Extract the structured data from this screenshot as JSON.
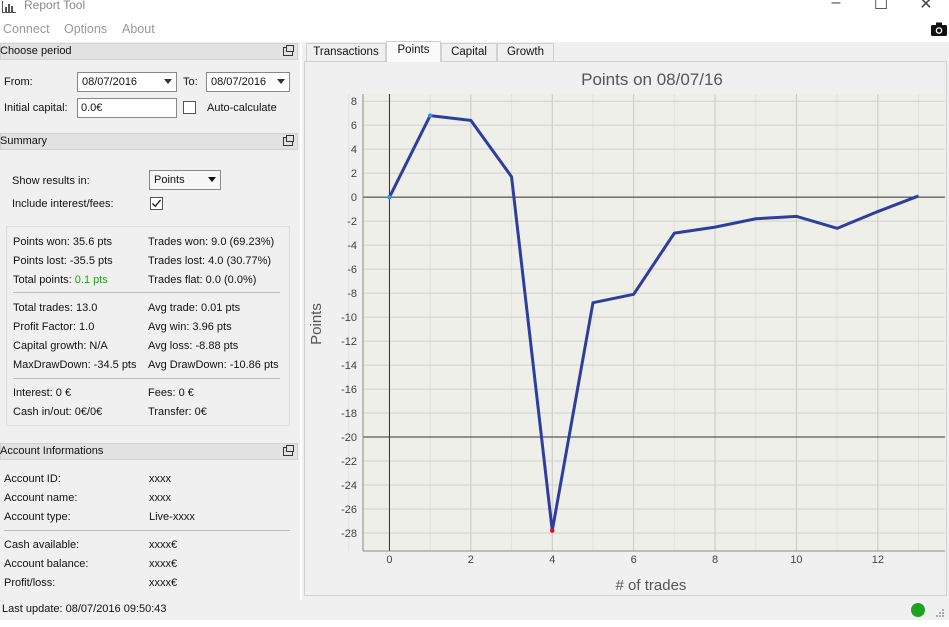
{
  "window": {
    "title": "Report Tool"
  },
  "menu": [
    "Connect",
    "Options",
    "About"
  ],
  "period": {
    "header": "Choose period",
    "from_label": "From:",
    "from_value": "08/07/2016",
    "to_label": "To:",
    "to_value": "08/07/2016",
    "capital_label": "Initial capital:",
    "capital_value": "0.0€",
    "autocalc_label": "Auto-calculate"
  },
  "summary": {
    "header": "Summary",
    "show_label": "Show results in:",
    "show_value": "Points",
    "include_label": "Include interest/fees:",
    "rows": [
      [
        "Points won: 35.6 pts",
        "Trades won: 9.0 (69.23%)"
      ],
      [
        "Points lost: -35.5 pts",
        "Trades lost: 4.0 (30.77%)"
      ],
      [
        "Total points: ",
        "Trades flat: 0.0 (0.0%)"
      ],
      [
        "Total trades: 13.0",
        "Avg trade: 0.01 pts"
      ],
      [
        "Profit Factor: 1.0",
        "Avg win: 3.96 pts"
      ],
      [
        "Capital growth: N/A",
        "Avg loss: -8.88 pts"
      ],
      [
        "MaxDrawDown: -34.5 pts",
        "Avg DrawDown: -10.86 pts"
      ],
      [
        "Interest: 0 €",
        "Fees: 0 €"
      ],
      [
        "Cash in/out: 0€/0€",
        "Transfer: 0€"
      ]
    ],
    "total_points_value": "0.1 pts"
  },
  "account": {
    "header": "Account Informations",
    "rows": [
      [
        "Account ID:",
        "xxxx"
      ],
      [
        "Account name:",
        "xxxx"
      ],
      [
        "Account type:",
        "Live-xxxx"
      ],
      [
        "Cash available:",
        "xxxx€"
      ],
      [
        "Account balance:",
        "xxxx€"
      ],
      [
        "Profit/loss:",
        "xxxx€"
      ]
    ]
  },
  "status": {
    "last_update": "Last update: 08/07/2016 09:50:43"
  },
  "tabs": [
    "Transactions",
    "Points",
    "Capital",
    "Growth"
  ],
  "active_tab": "Points",
  "colors": {
    "line": "#2e3d9e",
    "positive": "#1fa21f",
    "max_point": "#2196f3",
    "min_point": "#ff0000"
  },
  "chart_data": {
    "type": "line",
    "title": "Points on 08/07/16",
    "xlabel": "# of trades",
    "ylabel": "Points",
    "x": [
      0,
      1,
      2,
      3,
      4,
      5,
      6,
      7,
      8,
      9,
      10,
      11,
      12,
      13
    ],
    "values": [
      0,
      6.8,
      6.4,
      1.7,
      -27.8,
      -8.8,
      -8.1,
      -3.0,
      -2.5,
      -1.8,
      -1.6,
      -2.6,
      -1.2,
      0.1
    ],
    "xlim": [
      -0.65,
      13.65
    ],
    "ylim": [
      -29.5,
      8.6
    ],
    "xticks": [
      0,
      2,
      4,
      6,
      8,
      10,
      12
    ],
    "yticks": [
      8,
      6,
      4,
      2,
      0,
      -2,
      -4,
      -6,
      -8,
      -10,
      -12,
      -14,
      -16,
      -18,
      -20,
      -22,
      -24,
      -26,
      -28
    ],
    "grid": true,
    "highlight": {
      "max_index": 1,
      "min_index": 4
    }
  }
}
